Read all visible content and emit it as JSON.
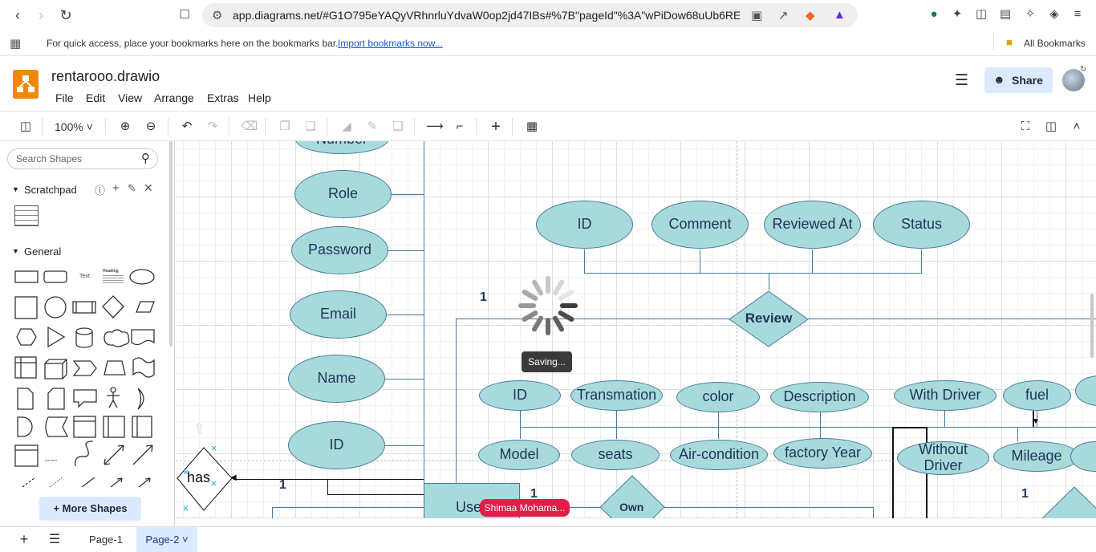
{
  "browser": {
    "url": "app.diagrams.net/#G1O795eYAQyVRhnrluYdvaW0op2jd47IBs#%7B\"pageId\"%3A\"wPiDow68uUb6REl...",
    "bookmarks_prompt": "For quick access, place your bookmarks here on the bookmarks bar.",
    "import_link": "Import bookmarks now...",
    "all_bookmarks": "All Bookmarks"
  },
  "app": {
    "file_title": "rentarooo.drawio",
    "menus": [
      "File",
      "Edit",
      "View",
      "Arrange",
      "Extras",
      "Help"
    ],
    "share_label": "Share"
  },
  "toolbar": {
    "zoom": "100%"
  },
  "sidebar": {
    "search_placeholder": "Search Shapes",
    "scratchpad": "Scratchpad",
    "general": "General",
    "text_shape": "Text",
    "heading_shape": "Heading",
    "list_item_shape": "List Item",
    "more_shapes": "+ More Shapes"
  },
  "canvas": {
    "attributes_left": [
      "Number",
      "Role",
      "Password",
      "Email",
      "Name",
      "ID"
    ],
    "review_attributes": [
      "ID",
      "Comment",
      "Reviewed At",
      "Status"
    ],
    "review_entity": "Review",
    "car_attributes_row1": [
      "ID",
      "Transmation",
      "color",
      "Description",
      "With Driver",
      "fuel"
    ],
    "car_attributes_row2": [
      "Model",
      "seats",
      "Air-condition",
      "factory Year",
      "Without Driver",
      "Mileage"
    ],
    "has_relation": "has",
    "own_relation": "Own",
    "user_entity": "User",
    "cardinality_1": "1",
    "saving_label": "Saving...",
    "collaborator": "Shimaa Mohama..."
  },
  "pages": {
    "add": "+",
    "tabs": [
      "Page-1",
      "Page-2"
    ],
    "active": "Page-2"
  },
  "colors": {
    "attribute_fill": "#a8dadc",
    "attribute_stroke": "#457b9d",
    "accent": "#f08705",
    "collaborator_badge": "#e11d48"
  }
}
